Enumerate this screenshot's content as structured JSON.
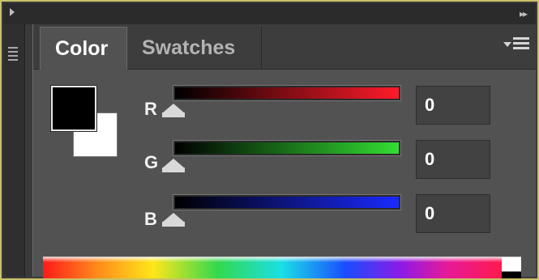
{
  "tabs": [
    {
      "label": "Color",
      "active": true
    },
    {
      "label": "Swatches",
      "active": false
    }
  ],
  "foreground_color": "#000000",
  "background_color": "#ffffff",
  "channels": [
    {
      "label": "R",
      "value": "0",
      "gradient_end": "#ff1a2a"
    },
    {
      "label": "G",
      "value": "0",
      "gradient_end": "#33dd33"
    },
    {
      "label": "B",
      "value": "0",
      "gradient_end": "#1a2aff"
    }
  ],
  "icons": {
    "collapse_left": "collapse-left-icon",
    "collapse_right": "expand-right-icon",
    "panel_menu": "panel-menu-icon",
    "grip": "panel-grip-icon"
  }
}
